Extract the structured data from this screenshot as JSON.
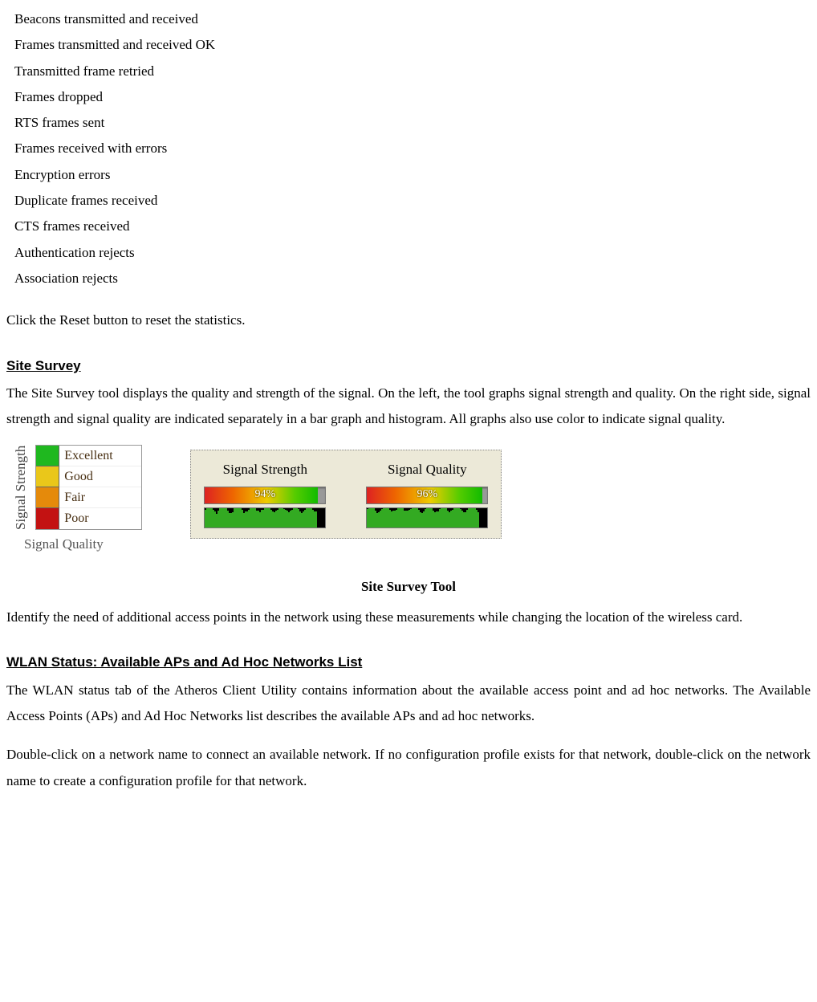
{
  "stats_list": [
    "Beacons transmitted and received",
    "Frames transmitted and received OK",
    "Transmitted frame retried",
    "Frames dropped",
    "RTS frames sent",
    "Frames received with errors",
    "Encryption errors",
    "Duplicate frames received",
    "CTS frames received",
    "Authentication rejects",
    "Association rejects"
  ],
  "reset_paragraph": "Click the Reset button to reset the statistics.",
  "site_survey": {
    "heading": "Site Survey",
    "description": "The Site Survey tool displays the quality and strength of the signal. On the left, the tool graphs signal strength and quality. On the right side, signal strength and signal quality are indicated separately in a bar graph and histogram. All graphs also use color to indicate signal quality.",
    "legend": {
      "y_axis": "Signal Strength",
      "x_axis": "Signal Quality",
      "levels": [
        {
          "label": "Excellent",
          "color": "#1fb81f"
        },
        {
          "label": "Good",
          "color": "#eac71a"
        },
        {
          "label": "Fair",
          "color": "#e58a0b"
        },
        {
          "label": "Poor",
          "color": "#c31212"
        }
      ]
    },
    "signal_strength": {
      "title": "Signal Strength",
      "value": "94%",
      "percent": 94
    },
    "signal_quality": {
      "title": "Signal Quality",
      "value": "96%",
      "percent": 96
    },
    "tool_caption": "Site Survey Tool",
    "after_caption": "Identify the need of additional access points in the network using these measurements while changing the location of the wireless card."
  },
  "wlan_status": {
    "heading": "WLAN Status: Available APs and Ad Hoc Networks List",
    "p1": "The WLAN status tab of the Atheros Client Utility contains information about the available access point and ad hoc networks.   The Available Access Points (APs) and Ad Hoc Networks list describes the available APs and ad hoc networks.",
    "p2": "Double-click on a network name to connect an available network. If no configuration profile exists for that network, double-click on the network name to create a configuration profile for that network."
  },
  "chart_data": {
    "type": "bar",
    "title": "Signal Strength / Signal Quality",
    "series": [
      {
        "name": "Signal Strength",
        "values": [
          94
        ]
      },
      {
        "name": "Signal Quality",
        "values": [
          96
        ]
      }
    ],
    "ylim": [
      0,
      100
    ],
    "legend_levels": [
      "Excellent",
      "Good",
      "Fair",
      "Poor"
    ]
  }
}
